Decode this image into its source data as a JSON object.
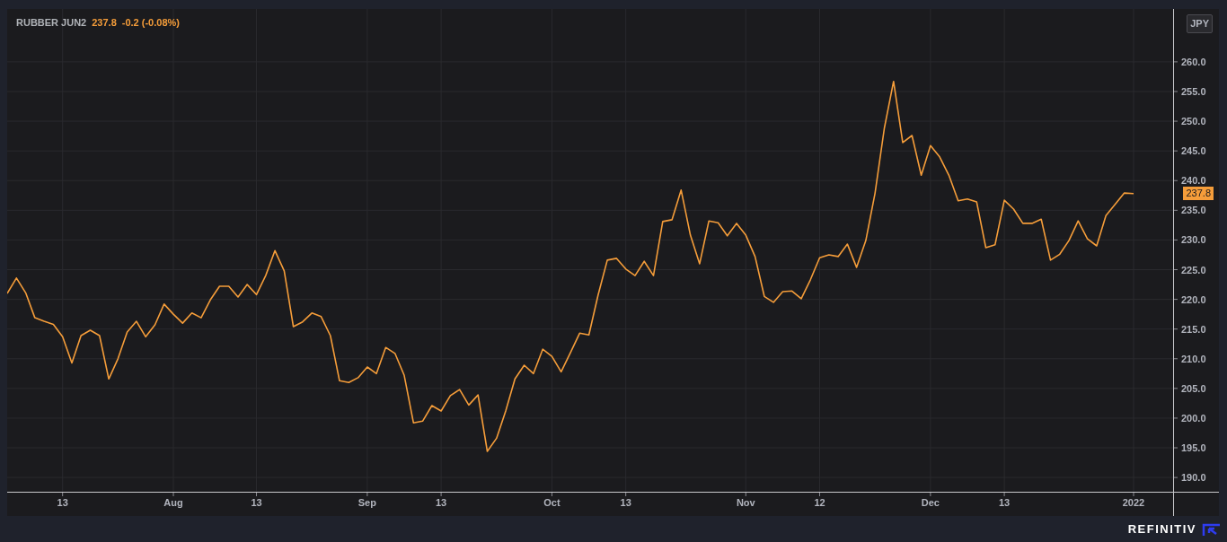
{
  "header": {
    "price": "237.8",
    "change": "-0.2 (-0.08%)"
  },
  "currency_badge": "JPY",
  "last_price_tag": "237.8",
  "chart_data": {
    "type": "line",
    "grid": true,
    "ylim": [
      187.6,
      268.9
    ],
    "categories": [
      null,
      null,
      null,
      null,
      null,
      null,
      "13",
      null,
      null,
      null,
      null,
      null,
      null,
      null,
      null,
      null,
      null,
      null,
      "Aug",
      null,
      null,
      null,
      null,
      null,
      null,
      null,
      null,
      "13",
      null,
      null,
      null,
      null,
      null,
      null,
      null,
      null,
      null,
      null,
      null,
      "Sep",
      null,
      null,
      null,
      null,
      null,
      null,
      null,
      "13",
      null,
      null,
      null,
      null,
      null,
      null,
      null,
      null,
      null,
      null,
      null,
      "Oct",
      null,
      null,
      null,
      null,
      null,
      null,
      null,
      "13",
      null,
      null,
      null,
      null,
      null,
      null,
      null,
      null,
      null,
      null,
      null,
      null,
      "Nov",
      null,
      null,
      null,
      null,
      null,
      null,
      null,
      "12",
      null,
      null,
      null,
      null,
      null,
      null,
      null,
      null,
      null,
      null,
      null,
      "Dec",
      null,
      null,
      null,
      null,
      null,
      null,
      null,
      "13",
      null,
      null,
      null,
      null,
      null,
      null,
      null,
      null,
      null,
      null,
      null,
      null,
      null,
      "2022"
    ],
    "yticks": [
      {
        "value": 190,
        "label": "190.0"
      },
      {
        "value": 195,
        "label": "195.0"
      },
      {
        "value": 200,
        "label": "200.0"
      },
      {
        "value": 205,
        "label": "205.0"
      },
      {
        "value": 210,
        "label": "210.0"
      },
      {
        "value": 215,
        "label": "215.0"
      },
      {
        "value": 220,
        "label": "220.0"
      },
      {
        "value": 225,
        "label": "225.0"
      },
      {
        "value": 230,
        "label": "230.0"
      },
      {
        "value": 235,
        "label": "235.0"
      },
      {
        "value": 240,
        "label": "240.0"
      },
      {
        "value": 245,
        "label": "245.0"
      },
      {
        "value": 250,
        "label": "250.0"
      },
      {
        "value": 255,
        "label": "255.0"
      },
      {
        "value": 260,
        "label": "260.0"
      }
    ],
    "series": [
      {
        "name": "RUBBER JUN2",
        "color": "#f59d3a",
        "values": [
          221.0,
          223.6,
          221.1,
          216.9,
          216.3,
          215.8,
          213.7,
          209.3,
          213.9,
          214.8,
          213.9,
          206.6,
          210.0,
          214.5,
          216.3,
          213.7,
          215.7,
          219.2,
          217.5,
          216.0,
          217.7,
          216.9,
          219.9,
          222.2,
          222.2,
          220.4,
          222.5,
          220.8,
          224.0,
          228.2,
          224.8,
          215.4,
          216.2,
          217.7,
          217.1,
          213.9,
          206.3,
          206.0,
          206.8,
          208.6,
          207.5,
          211.9,
          210.9,
          207.2,
          199.2,
          199.5,
          202.1,
          201.2,
          203.8,
          204.8,
          202.2,
          203.9,
          194.4,
          196.6,
          201.2,
          206.6,
          208.9,
          207.5,
          211.6,
          210.4,
          207.8,
          211.0,
          214.3,
          214.0,
          220.7,
          226.6,
          226.9,
          225.1,
          224.0,
          226.4,
          224.0,
          233.1,
          233.4,
          238.4,
          230.8,
          226.0,
          233.2,
          232.9,
          230.7,
          232.8,
          230.8,
          227.2,
          220.5,
          219.5,
          221.3,
          221.4,
          220.1,
          223.3,
          227.0,
          227.5,
          227.2,
          229.3,
          225.4,
          229.9,
          237.9,
          248.8,
          256.7,
          246.4,
          247.6,
          240.9,
          245.9,
          244.0,
          240.9,
          236.6,
          236.9,
          236.4,
          228.7,
          229.2,
          236.7,
          235.2,
          232.8,
          232.8,
          233.5,
          226.6,
          227.6,
          229.9,
          233.2,
          230.2,
          229.0,
          234.1,
          236.0,
          237.9,
          237.8
        ]
      }
    ]
  },
  "footer": {
    "brand": "REFINITIV"
  }
}
